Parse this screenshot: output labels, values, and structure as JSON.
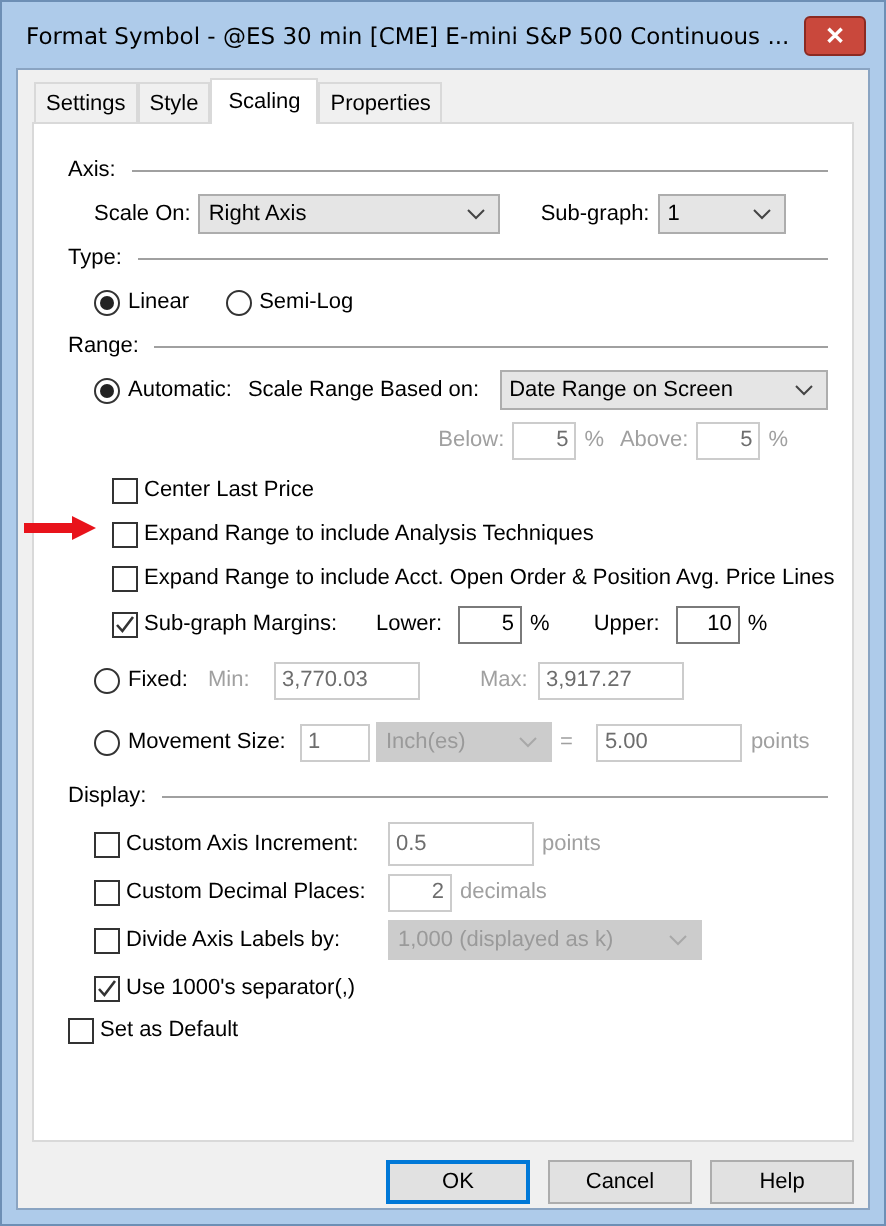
{
  "window": {
    "title": "Format Symbol - @ES 30 min [CME] E-mini S&P 500 Continuous ...",
    "close": "✕"
  },
  "tabs": [
    {
      "label": "Settings",
      "selected": false
    },
    {
      "label": "Style",
      "selected": false
    },
    {
      "label": "Scaling",
      "selected": true
    },
    {
      "label": "Properties",
      "selected": false
    }
  ],
  "axis": {
    "label": "Axis:",
    "scale_on": {
      "label": "Scale On:",
      "value": "Right Axis"
    },
    "sub_graph": {
      "label": "Sub-graph:",
      "value": "1"
    }
  },
  "type": {
    "label": "Type:",
    "options": [
      {
        "label": "Linear",
        "selected": true
      },
      {
        "label": "Semi-Log",
        "selected": false
      }
    ]
  },
  "range": {
    "label": "Range:",
    "automatic": {
      "label": "Automatic:",
      "selected": true,
      "based_on_label": "Scale Range Based on:",
      "based_on_value": "Date Range on Screen"
    },
    "below": {
      "label": "Below:",
      "value": "5",
      "unit": "%",
      "disabled": true
    },
    "above": {
      "label": "Above:",
      "value": "5",
      "unit": "%",
      "disabled": true
    },
    "checks": [
      {
        "label": "Center Last Price",
        "checked": false
      },
      {
        "label": "Expand Range to include Analysis Techniques",
        "checked": false
      },
      {
        "label": "Expand Range to include Acct. Open Order & Position Avg. Price Lines",
        "checked": false
      }
    ],
    "margins": {
      "label": "Sub-graph Margins:",
      "checked": true,
      "lower": {
        "label": "Lower:",
        "value": "5",
        "unit": "%"
      },
      "upper": {
        "label": "Upper:",
        "value": "10",
        "unit": "%"
      }
    },
    "fixed": {
      "label": "Fixed:",
      "selected": false,
      "disabled": true,
      "min": {
        "label": "Min:",
        "value": "3,770.03"
      },
      "max": {
        "label": "Max:",
        "value": "3,917.27"
      }
    },
    "movement": {
      "label": "Movement Size:",
      "selected": false,
      "disabled": true,
      "count": "1",
      "unit": "Inch(es)",
      "equals": "=",
      "amount": "5.00",
      "suffix": "points"
    }
  },
  "display": {
    "label": "Display:",
    "rows": [
      {
        "kind": "text",
        "label": "Custom Axis Increment:",
        "checked": false,
        "value": "0.5",
        "suffix": "points",
        "disabled": true
      },
      {
        "kind": "number",
        "label": "Custom Decimal Places:",
        "checked": false,
        "value": "2",
        "suffix": "decimals",
        "disabled": true
      },
      {
        "kind": "select",
        "label": "Divide Axis Labels by:",
        "checked": false,
        "value": "1,000 (displayed as k)",
        "disabled": true
      },
      {
        "kind": "plain",
        "label": "Use 1000's separator(,)",
        "checked": true
      }
    ]
  },
  "set_as_default": {
    "label": "Set as Default",
    "checked": false
  },
  "buttons": [
    {
      "label": "OK",
      "default": true
    },
    {
      "label": "Cancel",
      "default": false
    },
    {
      "label": "Help",
      "default": false
    }
  ]
}
